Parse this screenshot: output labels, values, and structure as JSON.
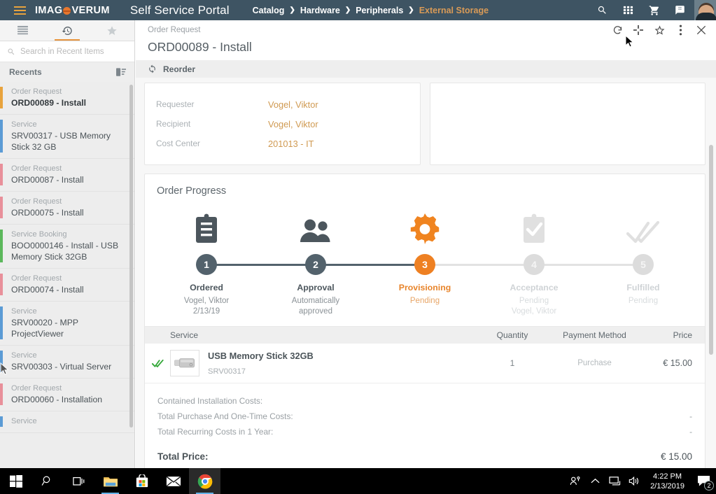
{
  "header": {
    "brand_part1": "IMAG",
    "brand_part2": "VERUM",
    "portal_title": "Self Service Portal",
    "breadcrumb": [
      {
        "label": "Catalog",
        "current": false
      },
      {
        "label": "Hardware",
        "current": false
      },
      {
        "label": "Peripherals",
        "current": false
      },
      {
        "label": "External Storage",
        "current": true
      }
    ],
    "icons": [
      "menu-icon",
      "search-icon",
      "apps-grid-icon",
      "shopping-cart-icon",
      "chat-icon",
      "avatar"
    ]
  },
  "sidebar": {
    "tabs": [
      {
        "name": "list-icon",
        "active": false
      },
      {
        "name": "history-icon",
        "active": true
      },
      {
        "name": "star-icon",
        "active": false
      }
    ],
    "search_placeholder": "Search in Recent Items",
    "search_value": "",
    "section_title": "Recents",
    "sort_icon": "sort-list-icon",
    "items": [
      {
        "type": "Order Request",
        "name": "ORD00089 - Install",
        "color": "#e8a33d",
        "selected": true
      },
      {
        "type": "Service",
        "name": "SRV00317 - USB Memory Stick 32 GB",
        "color": "#5b9bd5",
        "selected": false
      },
      {
        "type": "Order Request",
        "name": "ORD00087 - Install",
        "color": "#e8909a",
        "selected": false
      },
      {
        "type": "Order Request",
        "name": "ORD00075 - Install",
        "color": "#e8909a",
        "selected": false
      },
      {
        "type": "Service Booking",
        "name": "BOO0000146 - Install - USB Memory Stick 32GB",
        "color": "#5cb85c",
        "selected": false
      },
      {
        "type": "Order Request",
        "name": "ORD00074 - Install",
        "color": "#e8909a",
        "selected": false
      },
      {
        "type": "Service",
        "name": "SRV00020 - MPP ProjectViewer",
        "color": "#5b9bd5",
        "selected": false
      },
      {
        "type": "Service",
        "name": "SRV00303 - Virtual Server",
        "color": "#5b9bd5",
        "selected": false
      },
      {
        "type": "Order Request",
        "name": "ORD00060 - Installation",
        "color": "#e8909a",
        "selected": false
      },
      {
        "type": "Service",
        "name": "",
        "color": "#5b9bd5",
        "selected": false
      }
    ]
  },
  "detail": {
    "kicker": "Order Request",
    "title": "ORD00089 - Install",
    "reorder_label": "Reorder",
    "actions": [
      "refresh-icon",
      "expand-icon",
      "star-icon",
      "more-vertical-icon",
      "close-icon"
    ],
    "info": [
      {
        "key": "Requester",
        "value": "Vogel, Viktor"
      },
      {
        "key": "Recipient",
        "value": "Vogel, Viktor"
      },
      {
        "key": "Cost Center",
        "value": "201013 - IT"
      }
    ],
    "progress_title": "Order Progress",
    "steps": [
      {
        "num": "1",
        "label": "Ordered",
        "sub1": "Vogel, Viktor",
        "sub2": "2/13/19",
        "state": "done",
        "icon": "clipboard-icon"
      },
      {
        "num": "2",
        "label": "Approval",
        "sub1": "Automatically",
        "sub2": "approved",
        "state": "done",
        "icon": "people-icon"
      },
      {
        "num": "3",
        "label": "Provisioning",
        "sub1": "Pending",
        "sub2": "",
        "state": "active",
        "icon": "gear-icon"
      },
      {
        "num": "4",
        "label": "Acceptance",
        "sub1": "Pending",
        "sub2": "Vogel, Viktor",
        "state": "todo",
        "icon": "clipboard-check-icon"
      },
      {
        "num": "5",
        "label": "Fulfilled",
        "sub1": "Pending",
        "sub2": "",
        "state": "todo",
        "icon": "double-check-icon"
      }
    ],
    "table": {
      "columns": [
        "Service",
        "Quantity",
        "Payment Method",
        "Price"
      ],
      "rows": [
        {
          "status_icon": "green-double-check-icon",
          "thumb": "usb-stick-image",
          "name": "USB Memory Stick 32GB",
          "id": "SRV00317",
          "quantity": "1",
          "payment": "Purchase",
          "price": "€ 15.00"
        }
      ]
    },
    "totals": [
      {
        "label": "Contained Installation Costs:",
        "value": ""
      },
      {
        "label": "Total Purchase And One-Time Costs:",
        "value": "-"
      },
      {
        "label": "Total Recurring Costs in 1 Year:",
        "value": "-"
      }
    ],
    "grand_total": {
      "label": "Total Price:",
      "value": "€ 15.00"
    }
  },
  "taskbar": {
    "items": [
      "windows-start-icon",
      "search-icon",
      "task-view-icon",
      "file-explorer-icon",
      "microsoft-store-icon",
      "mail-icon",
      "chrome-icon"
    ],
    "tray": [
      "people-share-icon",
      "chevron-up-icon",
      "network-icon",
      "volume-icon"
    ],
    "time": "4:22 PM",
    "date": "2/13/2019",
    "notification_count": "2"
  },
  "colors": {
    "header_bg": "#3e5463",
    "accent_orange": "#e8842a",
    "link_orange": "#d09a52",
    "step_done": "#53626c"
  }
}
